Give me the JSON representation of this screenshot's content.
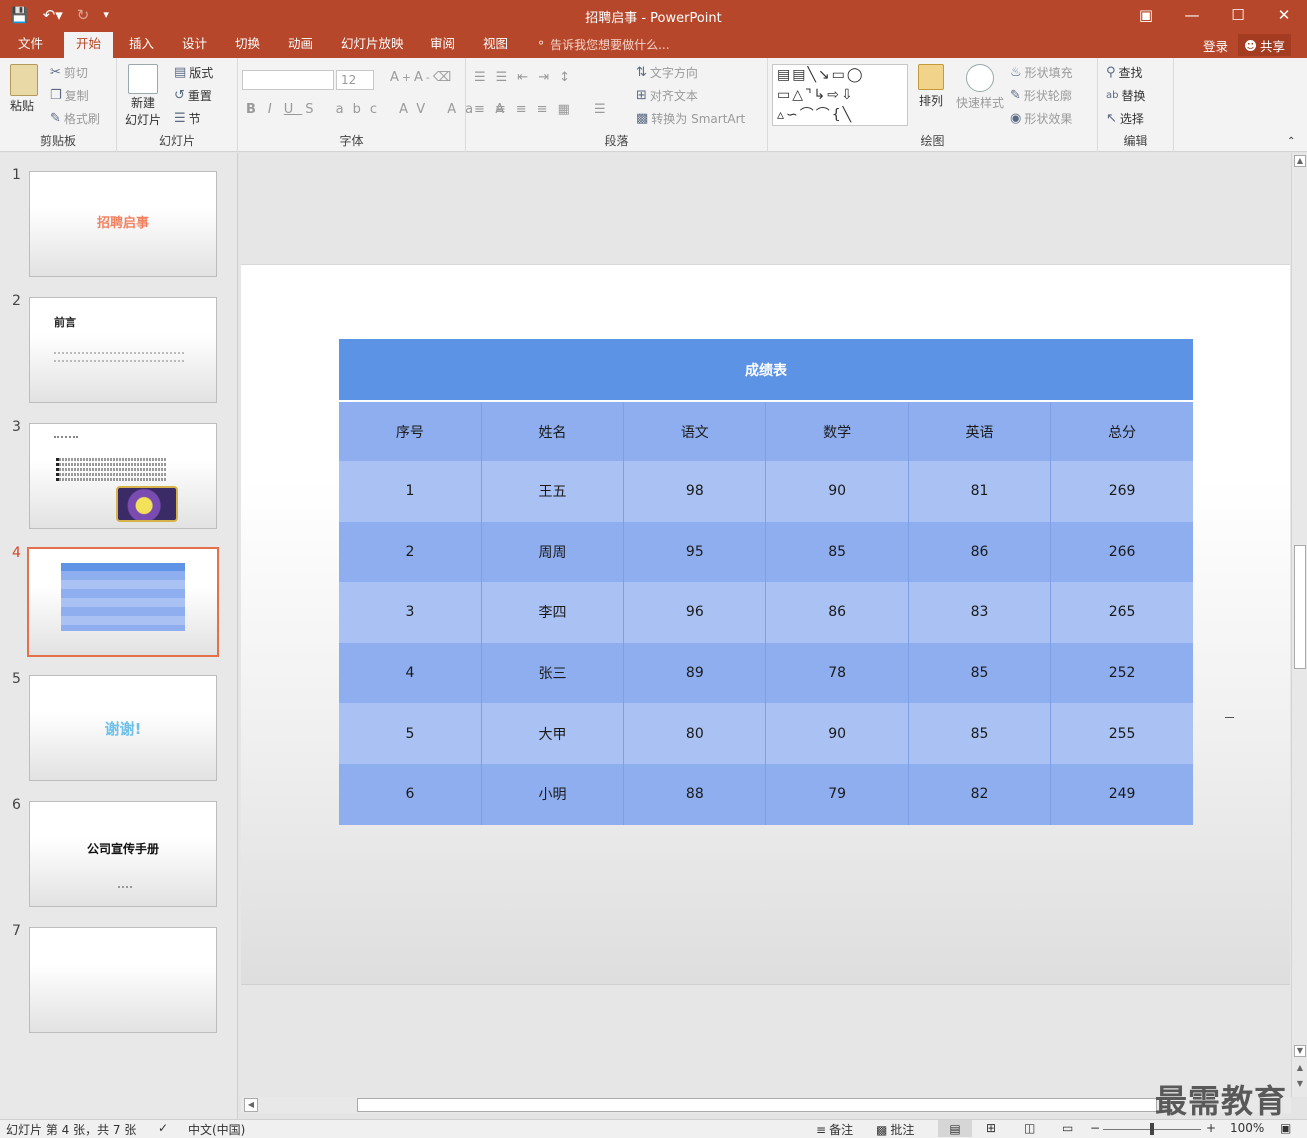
{
  "window": {
    "title": "招聘启事 - PowerPoint"
  },
  "tabs": [
    "文件",
    "开始",
    "插入",
    "设计",
    "切换",
    "动画",
    "幻灯片放映",
    "审阅",
    "视图"
  ],
  "active_tab": "开始",
  "tell_me": "告诉我您想要做什么...",
  "account": {
    "login": "登录",
    "share": "共享"
  },
  "ribbon": {
    "clipboard": {
      "label": "剪贴板",
      "paste": "粘贴",
      "cut": "剪切",
      "copy": "复制",
      "format_painter": "格式刷"
    },
    "slides": {
      "label": "幻灯片",
      "new_slide_1": "新建",
      "new_slide_2": "幻灯片",
      "layout": "版式",
      "reset": "重置",
      "section": "节"
    },
    "font": {
      "label": "字体",
      "size": "12"
    },
    "paragraph": {
      "label": "段落",
      "text_direction": "文字方向",
      "align_text": "对齐文本",
      "smartart": "转换为 SmartArt"
    },
    "drawing": {
      "label": "绘图",
      "arrange": "排列",
      "quick_styles": "快速样式",
      "shape_fill": "形状填充",
      "shape_outline": "形状轮廓",
      "shape_effects": "形状效果"
    },
    "editing": {
      "label": "编辑",
      "find": "查找",
      "replace": "替换",
      "select": "选择"
    }
  },
  "thumbnails": {
    "numbers": [
      "1",
      "2",
      "3",
      "4",
      "5",
      "6",
      "7"
    ],
    "active": "4",
    "slide1_title": "招聘启事",
    "slide2_title": "前言",
    "slide5_title": "谢谢!",
    "slide6_title": "公司宣传手册"
  },
  "slide_table": {
    "caption": "成绩表",
    "headers": [
      "序号",
      "姓名",
      "语文",
      "数学",
      "英语",
      "总分"
    ],
    "rows": [
      [
        "1",
        "王五",
        "98",
        "90",
        "81",
        "269"
      ],
      [
        "2",
        "周周",
        "95",
        "85",
        "86",
        "266"
      ],
      [
        "3",
        "李四",
        "96",
        "86",
        "83",
        "265"
      ],
      [
        "4",
        "张三",
        "89",
        "78",
        "85",
        "252"
      ],
      [
        "5",
        "大甲",
        "80",
        "90",
        "85",
        "255"
      ],
      [
        "6",
        "小明",
        "88",
        "79",
        "82",
        "249"
      ]
    ]
  },
  "statusbar": {
    "slide_info": "幻灯片 第 4 张，共 7 张",
    "language": "中文(中国)",
    "notes": "备注",
    "comments": "批注",
    "zoom": "100%"
  },
  "watermark": "最需教育",
  "colors": {
    "accent": "#b7472a",
    "table_header": "#5d93e5",
    "table_dark": "#8eaef0",
    "table_light": "#a9c1f3"
  }
}
